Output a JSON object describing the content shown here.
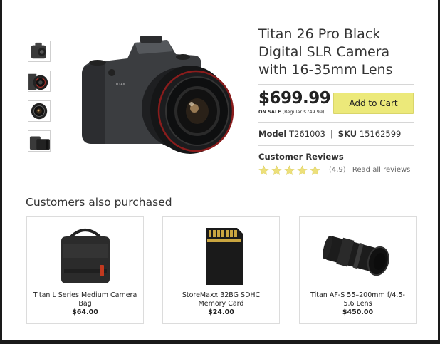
{
  "product": {
    "title": "Titan 26 Pro Black Digital SLR Camera with 16-35mm Lens",
    "price": "$699.99",
    "sale_label": "ON SALE",
    "regular_price": "(Regular $749.99)",
    "add_to_cart_label": "Add to Cart",
    "model_label": "Model",
    "model_value": "T261003",
    "separator": "|",
    "sku_label": "SKU",
    "sku_value": "15162599",
    "thumbnails": [
      "camera-body-icon",
      "camera-lens-icon",
      "camera-front-icon",
      "camera-side-icon"
    ],
    "main_image": "camera-icon"
  },
  "reviews": {
    "heading": "Customer Reviews",
    "star_count": 5,
    "rating_value": 4.9,
    "rating_text": "(4.9)",
    "read_all_label": "Read all reviews"
  },
  "also_purchased": {
    "heading": "Customers also purchased",
    "items": [
      {
        "name": "Titan L Series Medium Camera Bag",
        "price": "$64.00",
        "icon": "camera-bag-icon"
      },
      {
        "name": "StoreMaxx 32BG SDHC Memory Card",
        "price": "$24.00",
        "icon": "memory-card-icon"
      },
      {
        "name": "Titan AF-S 55–200mm f/4.5-5.6 Lens",
        "price": "$450.00",
        "icon": "zoom-lens-icon"
      }
    ]
  },
  "colors": {
    "accent_button": "#ece97a",
    "star": "#ede07a",
    "border": "#dcdcdc"
  }
}
